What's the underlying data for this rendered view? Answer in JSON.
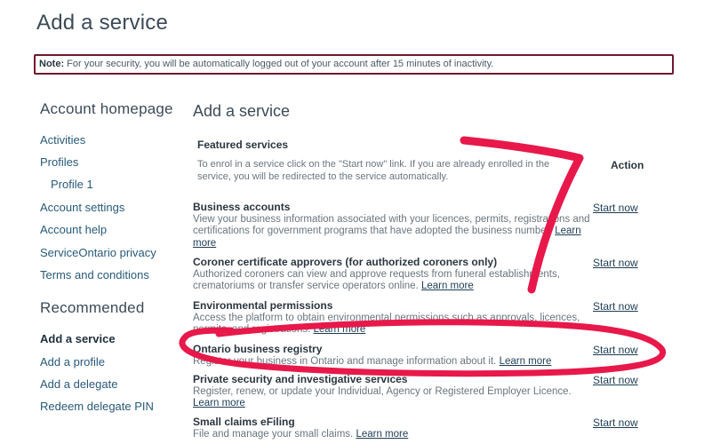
{
  "page": {
    "title": "Add a service"
  },
  "note": {
    "label": "Note:",
    "text": "For your security, you will be automatically logged out of your account after 15 minutes of inactivity."
  },
  "sidebar": {
    "heading1": "Account homepage",
    "items1": [
      "Activities",
      "Profiles",
      "Profile 1",
      "Account settings",
      "Account help",
      "ServiceOntario privacy",
      "Terms and conditions"
    ],
    "heading2": "Recommended",
    "items2": [
      "Add a service",
      "Add a profile",
      "Add a delegate",
      "Redeem delegate PIN"
    ]
  },
  "main": {
    "title": "Add a service",
    "featured_heading": "Featured services",
    "intro": "To enrol in a service click on the \"Start now\" link. If you are already enrolled in the service, you will be redirected to the service automatically.",
    "action_heading": "Action",
    "start_label": "Start now",
    "learn_more": "Learn more",
    "services": [
      {
        "name": "Business accounts",
        "desc": "View your business information associated with your licences, permits, registrations and certifications for government programs that have adopted the business number."
      },
      {
        "name": "Coroner certificate approvers (for authorized coroners only)",
        "desc": "Authorized coroners can view and approve requests from funeral establishments, crematoriums or transfer service operators online."
      },
      {
        "name": "Environmental permissions",
        "desc": "Access the platform to obtain environmental permissions such as approvals, licences, permits, and registrations."
      },
      {
        "name": "Ontario business registry",
        "desc": "Register your business in Ontario and manage information about it."
      },
      {
        "name": "Private security and investigative services",
        "desc": "Register, renew, or update your Individual, Agency or Registered Employer Licence."
      },
      {
        "name": "Small claims eFiling",
        "desc": "File and manage your small claims."
      }
    ]
  },
  "annotations": {
    "ink_color": "#e8184a"
  }
}
